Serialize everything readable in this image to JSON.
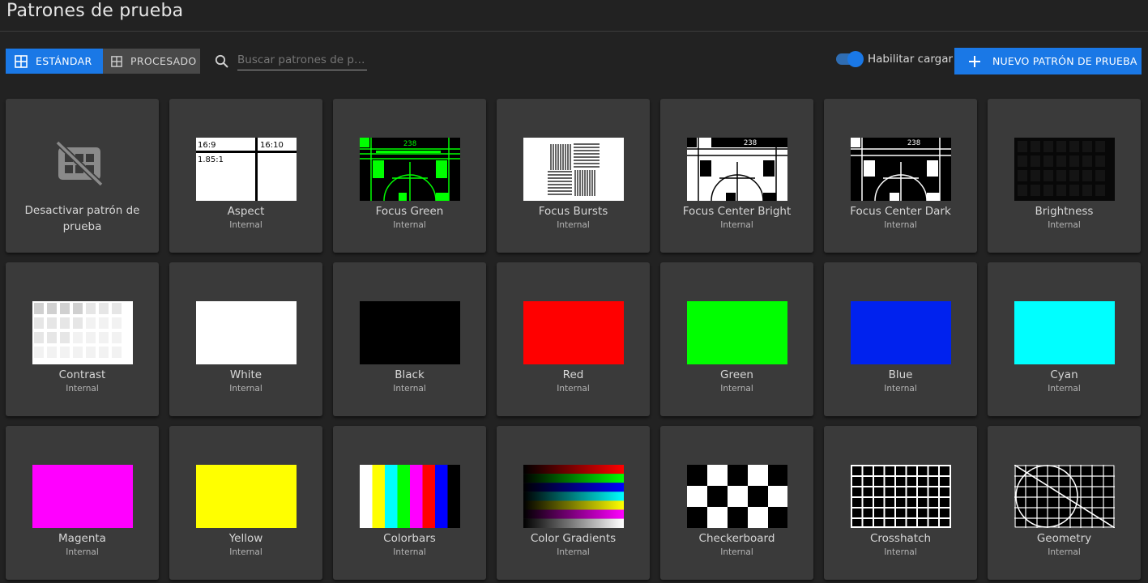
{
  "header": {
    "title": "Patrones de prueba"
  },
  "toolbar": {
    "standard_label": "ESTÁNDAR",
    "processed_label": "PROCESADO",
    "search_placeholder": "Buscar patrones de pru...",
    "enable_upload_label": "Habilitar cargar",
    "enable_upload_on": true,
    "new_pattern_label": "NUEVO PATRÓN DE PRUEBA"
  },
  "colors": {
    "accent": "#1a78e6",
    "card": "#3a3a3a",
    "background": "#222222"
  },
  "disable_card": {
    "label": "Desactivar patrón de prueba",
    "icon": "pattern-off-icon"
  },
  "aspect_labels": [
    "16:9",
    "16:10",
    "1.85:1"
  ],
  "focus_number": "238",
  "patterns": [
    {
      "name": "Aspect",
      "source": "Internal"
    },
    {
      "name": "Focus Green",
      "source": "Internal"
    },
    {
      "name": "Focus Bursts",
      "source": "Internal"
    },
    {
      "name": "Focus Center Bright",
      "source": "Internal"
    },
    {
      "name": "Focus Center Dark",
      "source": "Internal"
    },
    {
      "name": "Brightness",
      "source": "Internal"
    },
    {
      "name": "Contrast",
      "source": "Internal"
    },
    {
      "name": "White",
      "source": "Internal"
    },
    {
      "name": "Black",
      "source": "Internal"
    },
    {
      "name": "Red",
      "source": "Internal"
    },
    {
      "name": "Green",
      "source": "Internal"
    },
    {
      "name": "Blue",
      "source": "Internal"
    },
    {
      "name": "Cyan",
      "source": "Internal"
    },
    {
      "name": "Magenta",
      "source": "Internal"
    },
    {
      "name": "Yellow",
      "source": "Internal"
    },
    {
      "name": "Colorbars",
      "source": "Internal"
    },
    {
      "name": "Color Gradients",
      "source": "Internal"
    },
    {
      "name": "Checkerboard",
      "source": "Internal"
    },
    {
      "name": "Crosshatch",
      "source": "Internal"
    },
    {
      "name": "Geometry",
      "source": "Internal"
    }
  ]
}
